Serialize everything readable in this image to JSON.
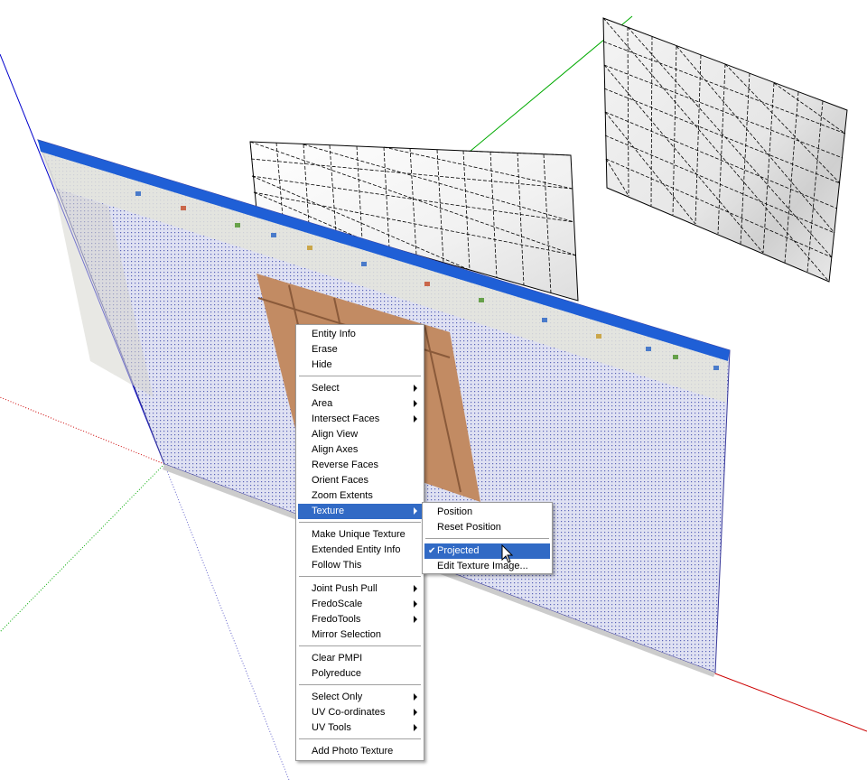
{
  "colors": {
    "axis_blue": "#0000cc",
    "axis_green": "#00aa00",
    "axis_red": "#cc0000",
    "title_bar": "#1f5fd6",
    "menu_highlight": "#316ac5",
    "projected_texture": "#c8cbe6",
    "wall_texture": "#c28b63"
  },
  "context_menu": {
    "items": [
      {
        "label": "Entity Info"
      },
      {
        "label": "Erase"
      },
      {
        "label": "Hide"
      },
      {
        "label": "Select",
        "submenu": true
      },
      {
        "label": "Area",
        "submenu": true
      },
      {
        "label": "Intersect Faces",
        "submenu": true
      },
      {
        "label": "Align View"
      },
      {
        "label": "Align Axes"
      },
      {
        "label": "Reverse Faces"
      },
      {
        "label": "Orient Faces"
      },
      {
        "label": "Zoom Extents"
      },
      {
        "label": "Texture",
        "submenu": true,
        "highlighted": true
      },
      {
        "label": "Make Unique Texture"
      },
      {
        "label": "Extended Entity Info"
      },
      {
        "label": "Follow This"
      },
      {
        "label": "Joint Push Pull",
        "submenu": true
      },
      {
        "label": "FredoScale",
        "submenu": true
      },
      {
        "label": "FredoTools",
        "submenu": true
      },
      {
        "label": "Mirror Selection"
      },
      {
        "label": "Clear PMPI"
      },
      {
        "label": "Polyreduce"
      },
      {
        "label": "Select Only",
        "submenu": true
      },
      {
        "label": "UV Co-ordinates",
        "submenu": true
      },
      {
        "label": "UV Tools",
        "submenu": true
      },
      {
        "label": "Add Photo Texture"
      }
    ]
  },
  "texture_submenu": {
    "items": [
      {
        "label": "Position"
      },
      {
        "label": "Reset Position"
      },
      {
        "label": "Projected",
        "checked": true,
        "highlighted": true,
        "check_glyph": "✔"
      },
      {
        "label": "Edit Texture Image..."
      }
    ]
  },
  "icons": {
    "cursor": "arrow-cursor-icon",
    "submenu_arrow": "chevron-right-icon",
    "check": "check-icon"
  }
}
